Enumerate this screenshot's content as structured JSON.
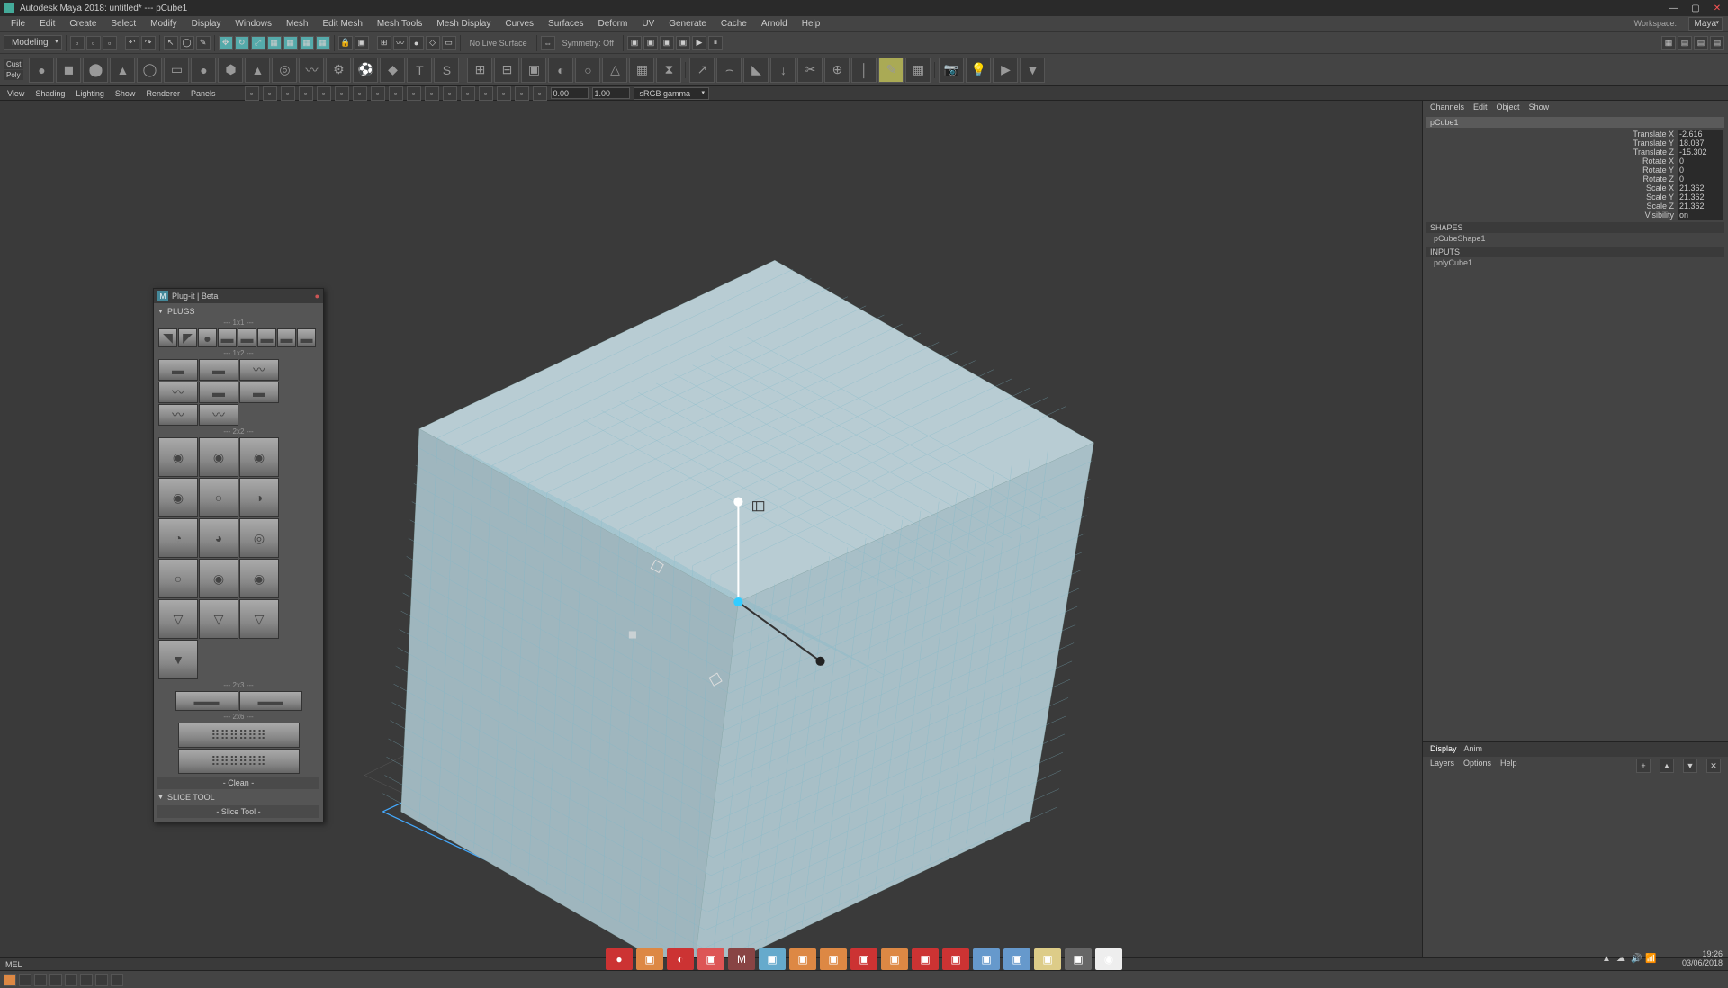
{
  "title": "Autodesk Maya 2018: untitled* --- pCube1",
  "menu": [
    "File",
    "Edit",
    "Create",
    "Select",
    "Modify",
    "Display",
    "Windows",
    "Mesh",
    "Edit Mesh",
    "Mesh Tools",
    "Mesh Display",
    "Curves",
    "Surfaces",
    "Deform",
    "UV",
    "Generate",
    "Cache",
    "Arnold",
    "Help"
  ],
  "workspace_label": "Workspace:",
  "workspace_value": "Maya",
  "mode_dropdown": "Modeling",
  "no_live_surface": "No Live Surface",
  "symmetry": "Symmetry: Off",
  "panel_menu": [
    "View",
    "Shading",
    "Lighting",
    "Show",
    "Renderer",
    "Panels"
  ],
  "field_a": "0.00",
  "field_b": "1.00",
  "gamma": "sRGB gamma",
  "channel_tabs": [
    "Channels",
    "Edit",
    "Object",
    "Show"
  ],
  "object_name": "pCube1",
  "attrs": [
    {
      "label": "Translate X",
      "value": "-2.616"
    },
    {
      "label": "Translate Y",
      "value": "18.037"
    },
    {
      "label": "Translate Z",
      "value": "-15.302"
    },
    {
      "label": "Rotate X",
      "value": "0"
    },
    {
      "label": "Rotate Y",
      "value": "0"
    },
    {
      "label": "Rotate Z",
      "value": "0"
    },
    {
      "label": "Scale X",
      "value": "21.362"
    },
    {
      "label": "Scale Y",
      "value": "21.362"
    },
    {
      "label": "Scale Z",
      "value": "21.362"
    },
    {
      "label": "Visibility",
      "value": "on"
    }
  ],
  "shapes_hdr": "SHAPES",
  "shape_name": "pCubeShape1",
  "inputs_hdr": "INPUTS",
  "input_name": "polyCube1",
  "display_tabs": [
    "Display",
    "Anim"
  ],
  "display_sub": [
    "Layers",
    "Options",
    "Help"
  ],
  "plugs": {
    "title": "Plug-it | Beta",
    "section1": "PLUGS",
    "sub1": "--- 1x1 ---",
    "sub2": "--- 1x2 ---",
    "sub3": "--- 2x2 ---",
    "sub4": "--- 2x3 ---",
    "sub5": "--- 2x6 ---",
    "clean": "- Clean -",
    "section2": "SLICE TOOL",
    "slice": "- Slice Tool -"
  },
  "mel": "MEL",
  "time": "19:26",
  "date": "03/06/2018"
}
